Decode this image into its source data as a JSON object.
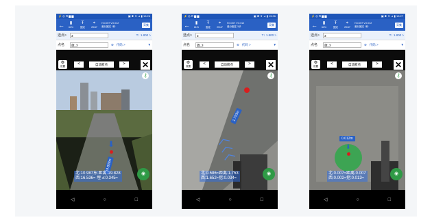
{
  "phones": [
    {
      "status": {
        "left": "⚡ ◎ ⊡ ▆ ▆",
        "right": "▣ ✱ ▼ ⊿ ▮ 15:26"
      },
      "stats": [
        {
          "icon": "▮",
          "label": "61%"
        },
        {
          "icon": "Ŧ",
          "label": "固定"
        },
        {
          "icon": "⌖",
          "label": "29/47"
        }
      ],
      "nums": [
        "H:0.007",
        "V:0.012"
      ],
      "sub": "差分固定 1秒",
      "edit": "采集",
      "point_label": "选点>",
      "point_value": "3",
      "height_value": "T↑ 1.800 >",
      "name_label": "点名",
      "name_value": "放_3",
      "code_label": "代码 >",
      "ctrl": {
        "settings": "设置",
        "left": "<",
        "auto": "自动箭点",
        "right": ">",
        "close": "✕"
      },
      "distance": "19.828m",
      "readout": [
        "北:10.987东:距离:19.828",
        "西:16.536≈ 埋 ±:0.345≈"
      ],
      "compass": "₰",
      "nav": [
        "◁",
        "○",
        "□"
      ]
    },
    {
      "status": {
        "left": "⚡ ◎ ⊡ ▆ ▆",
        "right": "▣ ✱ ▼ ⊿ ▮ 15:26"
      },
      "stats": [
        {
          "icon": "▮",
          "label": "61%"
        },
        {
          "icon": "Ŧ",
          "label": "固定"
        },
        {
          "icon": "⌖",
          "label": "29/47"
        }
      ],
      "nums": [
        "H:0.007",
        "V:0.012"
      ],
      "sub": "差分固定 1秒",
      "edit": "采集",
      "point_label": "选点>",
      "point_value": "3",
      "height_value": "T↑ 1.800 >",
      "name_label": "点名",
      "name_value": "放_3",
      "code_label": "代码 >",
      "ctrl": {
        "settings": "设置",
        "left": "<",
        "auto": "自动箭点",
        "right": ">",
        "close": "✕"
      },
      "distance": "1.753m",
      "readout": [
        "北:0.586≈距离:1.753",
        "西:1.652≈挖:0.034≈"
      ],
      "compass": "₰",
      "nav": [
        "◁",
        "○",
        "□"
      ]
    },
    {
      "status": {
        "left": "⚡ ◎ ⊡ ▆ ▆",
        "right": "▣ ✱ ▼ ⊿ ▮ 15:27"
      },
      "stats": [
        {
          "icon": "▮",
          "label": "61%"
        },
        {
          "icon": "Ŧ",
          "label": "固定"
        },
        {
          "icon": "⌖",
          "label": "29/47"
        }
      ],
      "nums": [
        "H:0.007",
        "V:0.012"
      ],
      "sub": "差分固定 1秒",
      "edit": "采集",
      "point_label": "选点>",
      "point_value": "3",
      "height_value": "T↑ 1.800 >",
      "name_label": "点名",
      "name_value": "放_3",
      "code_label": "代码 >",
      "ctrl": {
        "settings": "设置",
        "left": "<",
        "auto": "自动箭点",
        "right": ">",
        "close": "✕"
      },
      "distance": "0.012m",
      "readout": [
        "北:0.007≈距离:0.007",
        "西:0.002≈挖:0.013≈"
      ],
      "compass": "₰",
      "nav": [
        "◁",
        "○",
        "□"
      ]
    }
  ]
}
